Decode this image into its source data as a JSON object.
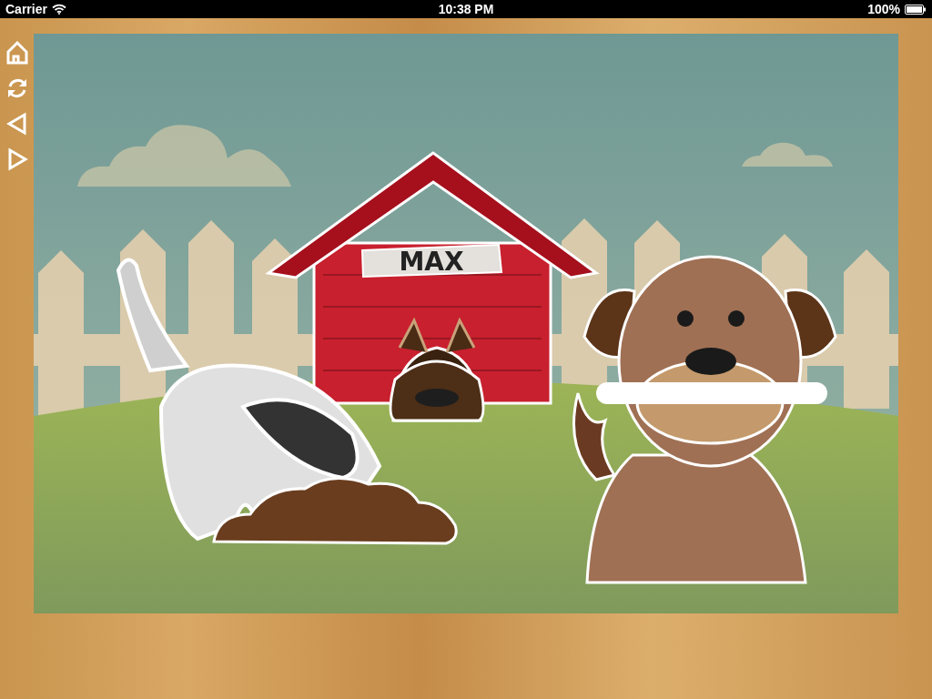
{
  "status_bar": {
    "carrier": "Carrier",
    "time": "10:38 PM",
    "battery": "100%"
  },
  "toolbar": [
    {
      "kind": "home"
    },
    {
      "kind": "restart"
    },
    {
      "kind": "previous"
    },
    {
      "kind": "next"
    }
  ],
  "scene": {
    "sign": "MAX"
  }
}
